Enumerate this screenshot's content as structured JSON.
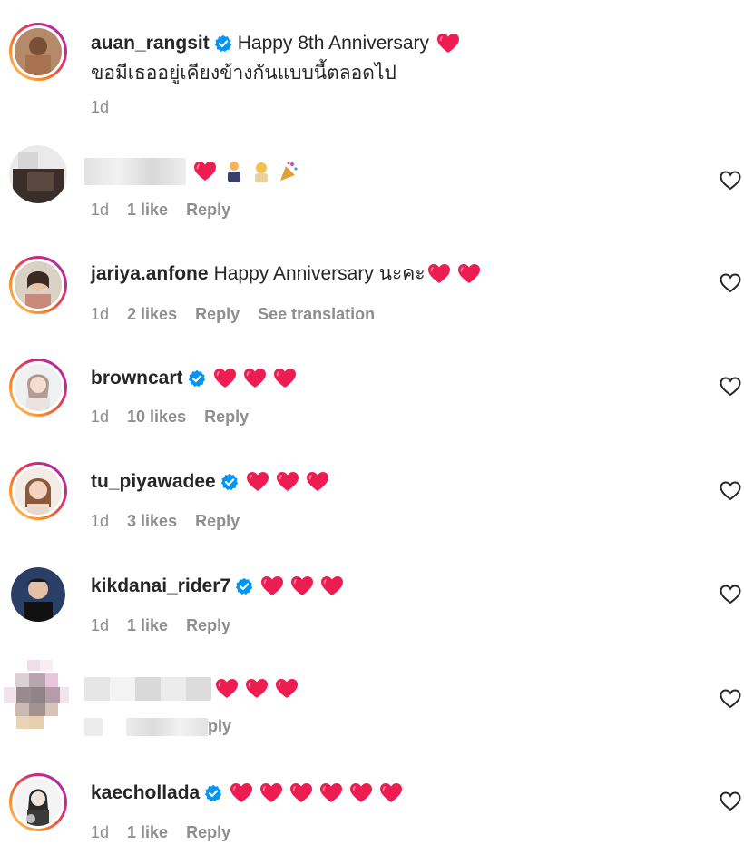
{
  "colors": {
    "heart": "#ed1d52",
    "verified": "#0095f6",
    "meta": "#8e8e8e"
  },
  "comments": [
    {
      "username": "auan_rangsit",
      "verified": true,
      "text": "Happy 8th Anniversary",
      "text2": "ขอมีเธออยู่เคียงข้างกันแบบนี้ตลอดไป",
      "hearts": 1,
      "time": "1d"
    },
    {
      "username": "",
      "hidden": true,
      "hearts": 1,
      "time": "1d",
      "likes": "1 like",
      "reply": "Reply"
    },
    {
      "username": "jariya.anfone",
      "verified": false,
      "text": "Happy Anniversary นะคะ",
      "hearts": 2,
      "time": "1d",
      "likes": "2 likes",
      "reply": "Reply",
      "translation": "See translation"
    },
    {
      "username": "browncart",
      "verified": true,
      "hearts": 3,
      "time": "1d",
      "likes": "10 likes",
      "reply": "Reply"
    },
    {
      "username": "tu_piyawadee",
      "verified": true,
      "hearts": 3,
      "time": "1d",
      "likes": "3 likes",
      "reply": "Reply"
    },
    {
      "username": "kikdanai_rider7",
      "verified": true,
      "hearts": 3,
      "time": "1d",
      "likes": "1 like",
      "reply": "Reply"
    },
    {
      "username": "",
      "hidden": true,
      "hearts": 3,
      "reply_partial": "ply"
    },
    {
      "username": "kaechollada",
      "verified": true,
      "hearts": 6,
      "time": "1d",
      "likes": "1 like",
      "reply": "Reply"
    }
  ]
}
